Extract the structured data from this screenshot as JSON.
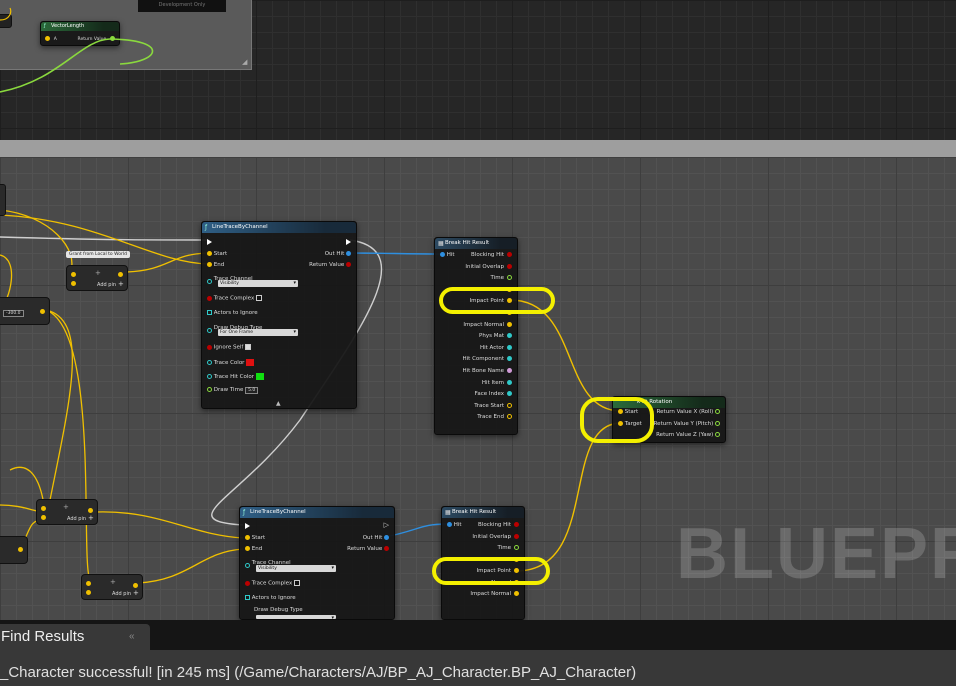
{
  "top_graph": {
    "comment_caption": "Development Only",
    "vector_length_node": {
      "title": "VectorLength",
      "pin_a": "A",
      "return_label": "Return Value"
    }
  },
  "nodes": {
    "line_trace_1": {
      "title": "LineTraceByChannel",
      "start": "Start",
      "end": "End",
      "out_hit": "Out Hit",
      "return_value": "Return Value",
      "trace_channel_label": "Trace Channel",
      "trace_channel_value": "Visibility",
      "trace_complex": "Trace Complex",
      "actors_to_ignore": "Actors to Ignore",
      "draw_debug_type_label": "Draw Debug Type",
      "draw_debug_type_value": "For One Frame",
      "ignore_self": "Ignore Self",
      "trace_color": "Trace Color",
      "trace_hit_color": "Trace Hit Color",
      "draw_time": "Draw Time",
      "draw_time_value": "5.0"
    },
    "break_hit_1": {
      "title": "Break Hit Result",
      "hit": "Hit",
      "outputs": [
        "Blocking Hit",
        "Initial Overlap",
        "Time",
        "Location",
        "Impact Point",
        "Normal",
        "Impact Normal",
        "Phys Mat",
        "Hit Actor",
        "Hit Component",
        "Hit Bone Name",
        "Hit Item",
        "Face Index",
        "Trace Start",
        "Trace End"
      ]
    },
    "find_look_at": {
      "title": "Find Look at Rotation",
      "title_visible": "k at Rotation",
      "start": "Start",
      "target": "Target",
      "outputs": [
        "Return Value X (Roll)",
        "Return Value Y (Pitch)",
        "Return Value Z (Yaw)"
      ]
    },
    "line_trace_2": {
      "title": "LineTraceByChannel",
      "start": "Start",
      "end": "End",
      "out_hit": "Out Hit",
      "return_value": "Return Value",
      "trace_channel_label": "Trace Channel",
      "trace_channel_value": "Visibility",
      "trace_complex": "Trace Complex",
      "actors_to_ignore": "Actors to Ignore",
      "draw_debug_type_label": "Draw Debug Type"
    },
    "break_hit_2": {
      "title": "Break Hit Result",
      "hit": "Hit",
      "outputs": [
        "Blocking Hit",
        "Initial Overlap",
        "Time",
        "Location",
        "Impact Point",
        "Normal",
        "Impact Normal"
      ]
    },
    "add_pin_label": "Add pin",
    "convert_tag": "Grant from Local to World",
    "value_box": "-300.0"
  },
  "watermark": "BLUEPRI",
  "colors": {
    "exec": "#ffffff",
    "vector": "#f0c000",
    "struct": "#2e8fe0",
    "bool": "#b00000",
    "float": "#8ad93e",
    "highlight": "#f4f000",
    "trace_color": "#e01010",
    "trace_hit_color": "#10e010"
  },
  "bottom": {
    "tab_label": "Find Results",
    "status_text": "_Character successful! [in 245 ms] (/Game/Characters/AJ/BP_AJ_Character.BP_AJ_Character)"
  }
}
